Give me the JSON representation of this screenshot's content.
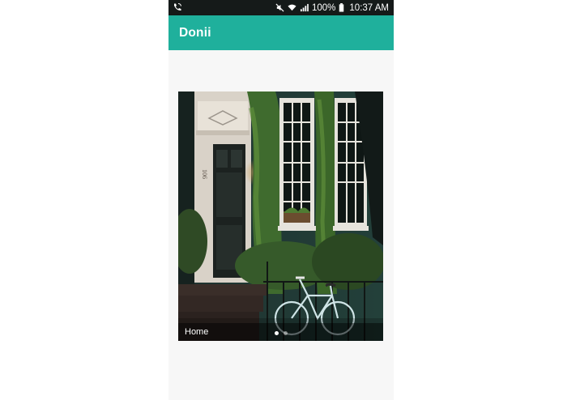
{
  "status_bar": {
    "left_icon": "phone-wifi-calling-icon",
    "icons": [
      "mute-icon",
      "wifi-icon",
      "signal-icon"
    ],
    "battery": "100%",
    "battery_icon": "battery-full-icon",
    "time": "10:37 AM"
  },
  "app_bar": {
    "title": "Donii",
    "color": "#1fb09c"
  },
  "carousel": {
    "caption": "Home",
    "image": "house-door-ivy-bicycle-photo",
    "pages": 2,
    "active_page": 1
  }
}
